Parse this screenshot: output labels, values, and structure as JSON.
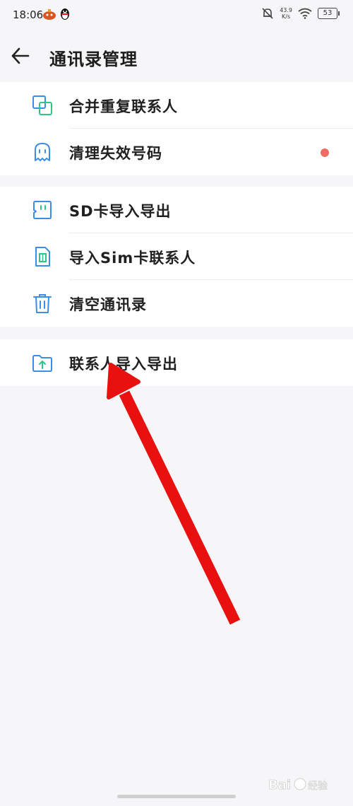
{
  "status_bar": {
    "time": "18:06",
    "net_speed_value": "43.9",
    "net_speed_unit": "K/s",
    "battery": "53"
  },
  "header": {
    "title": "通讯录管理"
  },
  "groups": [
    {
      "items": [
        {
          "label": "合并重复联系人",
          "icon": "merge-contacts-icon"
        },
        {
          "label": "清理失效号码",
          "icon": "ghost-icon",
          "badge": "red-dot"
        }
      ]
    },
    {
      "items": [
        {
          "label": "SD卡导入导出",
          "icon": "sd-card-icon"
        },
        {
          "label": "导入Sim卡联系人",
          "icon": "sim-card-icon"
        },
        {
          "label": "清空通讯录",
          "icon": "trash-icon"
        }
      ]
    },
    {
      "items": [
        {
          "label": "联系人导入导出",
          "icon": "folder-upload-icon"
        }
      ]
    }
  ],
  "colors": {
    "accent_blue": "#3a8ee6",
    "accent_green": "#2cc58a",
    "badge_red": "#ef6b64",
    "annotation_arrow": "#e8110f"
  }
}
